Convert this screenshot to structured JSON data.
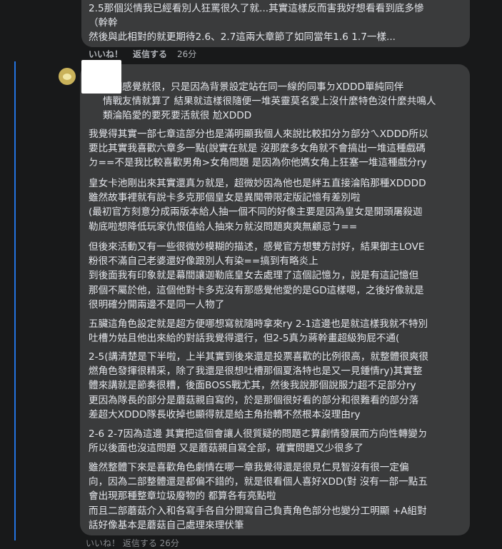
{
  "top_comment": {
    "text": "2.5那個災情我已經看別人狂罵很久了就...其實這樣反而害我好想看看到底多慘\n（幹幹\n然後與此相對的就更期待2.6、2.7這兩大章節了如同當年1.6 1.7一樣...",
    "like_label": "いいね！",
    "reply_label": "返信する",
    "time": "26分"
  },
  "reply": {
    "paragraphs": [
      "那個感覺就很，只是因為背景設定站在同一線的同事ㄉXDDD單純同伴\n情戰友情就算了 結果就這樣很隨便一堆英靈莫名愛上沒什麼特色沒什麼共鳴人\n類淪陷愛的要死要活就很 尬XDDD",
      "我覺得其實一部七章這部分也是滿明顯我個人來說比較扣分ㄉ部分ㄟXDDD所以\n要比其實我喜歡六章多一點(說實在就是 沒那麼多女角就不會搞出一堆這種戲碼\nㄉ==不是我比較喜歡男角>女角問題 是因為你他媽女角上狂塞一堆這種戲分ry",
      "皇女卡池剛出來其實還真ㄉ就是，超微妙因為他也是絆五直接淪陷那種XDDDD\n雖然故事裡就有說卡多克那個皇女是異聞帶限定版記憶有差別啦\n(最初官方刻意分成兩版本給人抽一個不同的好像主要是因為皇女是開頭屠殺迦\n勒底啦想降低玩家仇恨值給人抽來ㄉ就沒問題爽爽無顧忌ㄅ==",
      "但後來活動又有一些很微妙模糊的描述，感覺官方想雙方討好，結果御主LOVE\n粉很不滿自己老婆還好像跟別人有染==搞到有略炎上\n到後面我有印象就是幕間讓迦勒底皇女去處理了這個記憶ㄉ，說是有這記憶但\n那個不屬於他，這個他對卡多克沒有那感覺他愛的是GD這樣嗯，之後好像就是\n很明確分開兩邊不是同一人物了",
      "五臟這角色設定就是超方便哪想寫就隨時拿來ry 2-1這邊也是就這樣我就不特別\n吐槽ㄌ姑且他出來給的對話我覺得還行，但2-5真ㄉ蔣幹畫超級狗屁不通(",
      "2-5(講清楚是下半啦，上半其實到後來還是投票喜歡的比例很高，就整體很爽很\n燃角色發揮很精采，除了我還是很想吐槽那個夏洛特也是又一見鍾情ry)其實整\n體來講就是節奏很糟，後面BOSS戰尤其，然後我說那個說服力超不足部分ry\n更因為隊長的部分是蘑菇親自寫的，於是那個很好看的部分和很難看的部分落\n差超大XDDD隊長收掉也顯得就是給主角抬轎不然根本沒理由ry",
      "2-6 2-7因為這邊 其實把這個會讓人很質疑的問題ㄜ算劇情發展而方向性轉變ㄉ\n所以後面也沒這問題 又是蘑菇親自寫全部，確實問題又少很多了",
      "雖然整體下來是喜歡角色劇情在哪一章我覺得還是很見仁見智沒有很一定偏\n向，因為二部整體還是都偏不錯的，就是很看個人喜好XDD(對 沒有一部一點五\n會出現那種整章垃圾廢物的 都算各有亮點啦\n而且二部蘑菇介入和各寫手各自分開寫自己負責角色部分也變分工明顯 +A組對\n話好像基本是蘑菇自己處理來理伏筆"
    ],
    "footer_partial": "いいね！  返信する  26分"
  }
}
